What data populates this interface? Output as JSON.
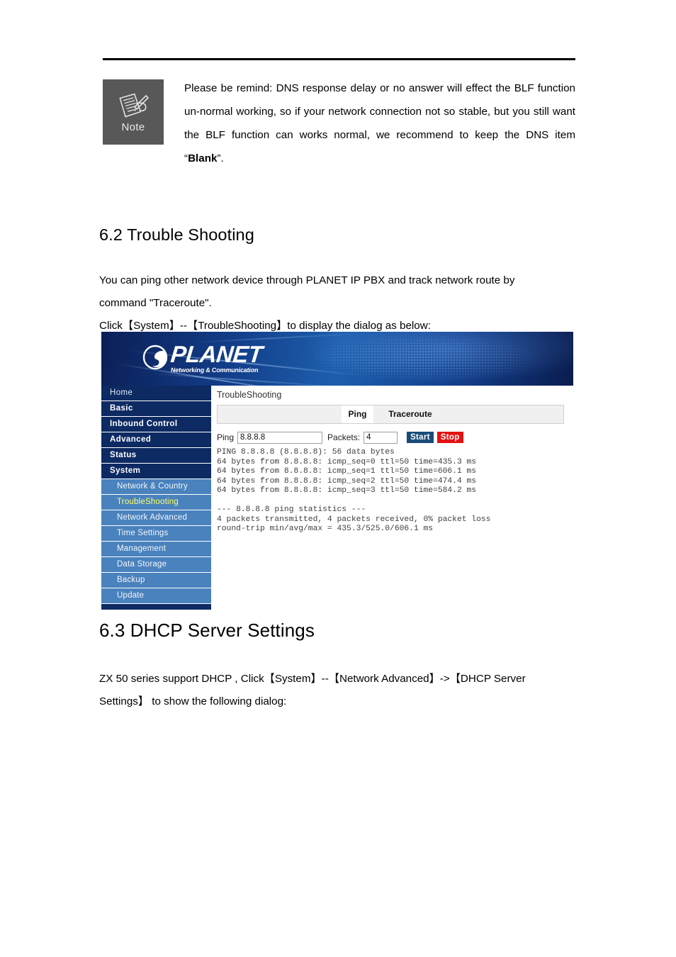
{
  "note": {
    "icon_label": "Note",
    "text_before": "Please be remind: DNS response delay or no answer will effect the BLF function un-normal working, so if your network connection not so stable, but you still want the BLF function can works normal, we recommend to keep the DNS item “",
    "bold_word": "Blank",
    "text_after": "”."
  },
  "sections": {
    "s62": {
      "heading": "6.2 Trouble Shooting",
      "para_line1": "You can ping other network device through PLANET IP PBX and track network route by",
      "para_line2": "command \"Traceroute\".",
      "para_line3": "Click【System】--【TroubleShooting】to display the dialog as below:"
    },
    "s63": {
      "heading": "6.3 DHCP Server Settings",
      "para_line1": "ZX 50 series support DHCP , Click【System】--【Network Advanced】->【DHCP Server",
      "para_line2": "Settings】  to show the following dialog:"
    }
  },
  "screenshot": {
    "banner": {
      "logo_name": "PLANET",
      "logo_tagline": "Networking & Communication"
    },
    "sidebar": {
      "top_items": [
        {
          "label": "Home",
          "style": "plain"
        },
        {
          "label": "Basic",
          "style": "bold"
        },
        {
          "label": "Inbound Control",
          "style": "bold"
        },
        {
          "label": "Advanced",
          "style": "bold"
        },
        {
          "label": "Status",
          "style": "bold"
        },
        {
          "label": "System",
          "style": "bold"
        }
      ],
      "sub_items": [
        {
          "label": "Network & Country",
          "active": false
        },
        {
          "label": "TroubleShooting",
          "active": true
        },
        {
          "label": "Network Advanced",
          "active": false
        },
        {
          "label": "Time Settings",
          "active": false
        },
        {
          "label": "Management",
          "active": false
        },
        {
          "label": "Data Storage",
          "active": false
        },
        {
          "label": "Backup",
          "active": false
        },
        {
          "label": "Update",
          "active": false
        }
      ]
    },
    "panel": {
      "title": "TroubleShooting",
      "tabs": [
        {
          "label": "Ping",
          "active": true
        },
        {
          "label": "Traceroute",
          "active": false
        }
      ],
      "form": {
        "ping_label": "Ping",
        "ping_value": "8.8.8.8",
        "packets_label": "Packets:",
        "packets_value": "4",
        "start_label": "Start",
        "stop_label": "Stop"
      },
      "terminal_output": "PING 8.8.8.8 (8.8.8.8): 56 data bytes\n64 bytes from 8.8.8.8: icmp_seq=0 ttl=50 time=435.3 ms\n64 bytes from 8.8.8.8: icmp_seq=1 ttl=50 time=606.1 ms\n64 bytes from 8.8.8.8: icmp_seq=2 ttl=50 time=474.4 ms\n64 bytes from 8.8.8.8: icmp_seq=3 ttl=50 time=584.2 ms\n\n--- 8.8.8.8 ping statistics ---\n4 packets transmitted, 4 packets received, 0% packet loss\nround-trip min/avg/max = 435.3/525.0/606.1 ms"
    },
    "colors": {
      "nav_top_bg": "#0d2a63",
      "nav_sub_bg": "#4a82bd",
      "nav_active_text": "#ffff66",
      "start_button": "#1a4c78",
      "stop_button": "#e41212"
    }
  }
}
